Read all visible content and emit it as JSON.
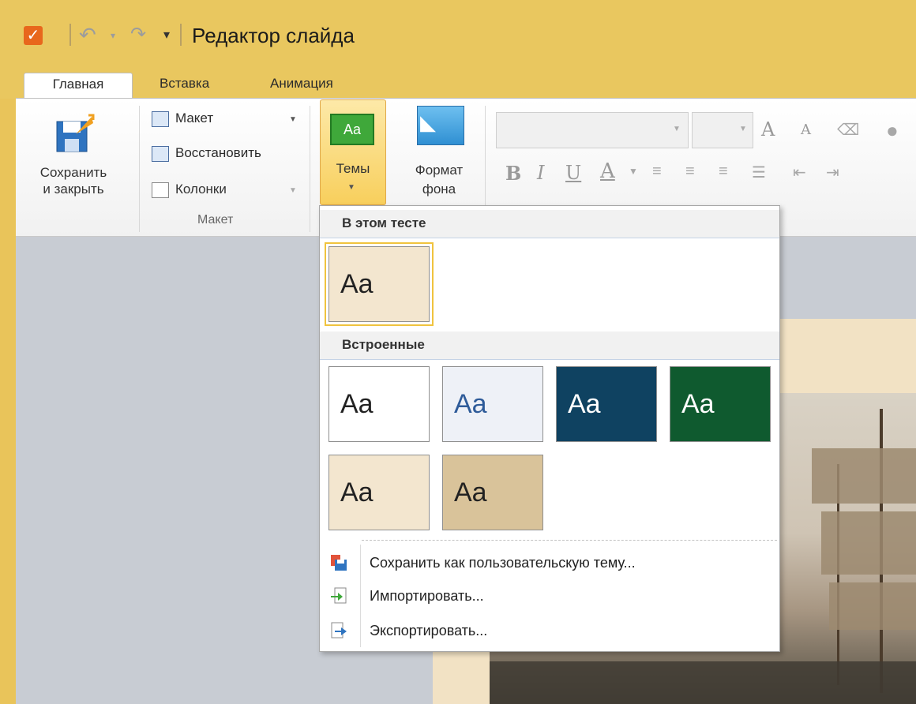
{
  "window": {
    "title": "Редактор слайда"
  },
  "tabs": [
    "Главная",
    "Вставка",
    "Анимация"
  ],
  "ribbon": {
    "save_close_line1": "Сохранить",
    "save_close_line2": "и закрыть",
    "layout_btn": "Макет",
    "restore_btn": "Восстановить",
    "columns_btn": "Колонки",
    "group_layout": "Макет",
    "themes_icon_text": "Aa",
    "themes_btn": "Темы",
    "bg_format_line1": "Формат",
    "bg_format_line2": "фона",
    "font_combo_value": "",
    "size_combo_value": "",
    "format_glyphs": {
      "bold": "B",
      "italic": "I",
      "underline": "U",
      "font_color": "A",
      "grow": "A",
      "shrink": "A"
    }
  },
  "themes_menu": {
    "section_current": "В этом тесте",
    "section_builtin": "Встроенные",
    "current_themes": [
      {
        "label": "Aa",
        "bg": "#f3e6cf",
        "color": "#222222"
      }
    ],
    "builtin_themes": [
      {
        "label": "Aa",
        "bg": "#ffffff",
        "color": "#222222"
      },
      {
        "label": "Aa",
        "bg": "#eef1f7",
        "color": "#2e5b99"
      },
      {
        "label": "Aa",
        "bg": "#0f4261",
        "color": "#ffffff"
      },
      {
        "label": "Aa",
        "bg": "#0f5a2f",
        "color": "#ffffff"
      },
      {
        "label": "Aa",
        "bg": "#f3e6cf",
        "color": "#222222"
      },
      {
        "label": "Aa",
        "bg": "#d9c39a",
        "color": "#222222"
      }
    ],
    "items": [
      {
        "label": "Сохранить как пользовательскую тему...",
        "icon": "save-theme-icon"
      },
      {
        "label": "Импортировать...",
        "icon": "import-icon"
      },
      {
        "label": "Экспортировать...",
        "icon": "export-icon"
      }
    ]
  },
  "colors": {
    "title_bar": "#e9c75f",
    "accent_orange": "#e8671c",
    "selected_gold": "#f0c33e"
  }
}
